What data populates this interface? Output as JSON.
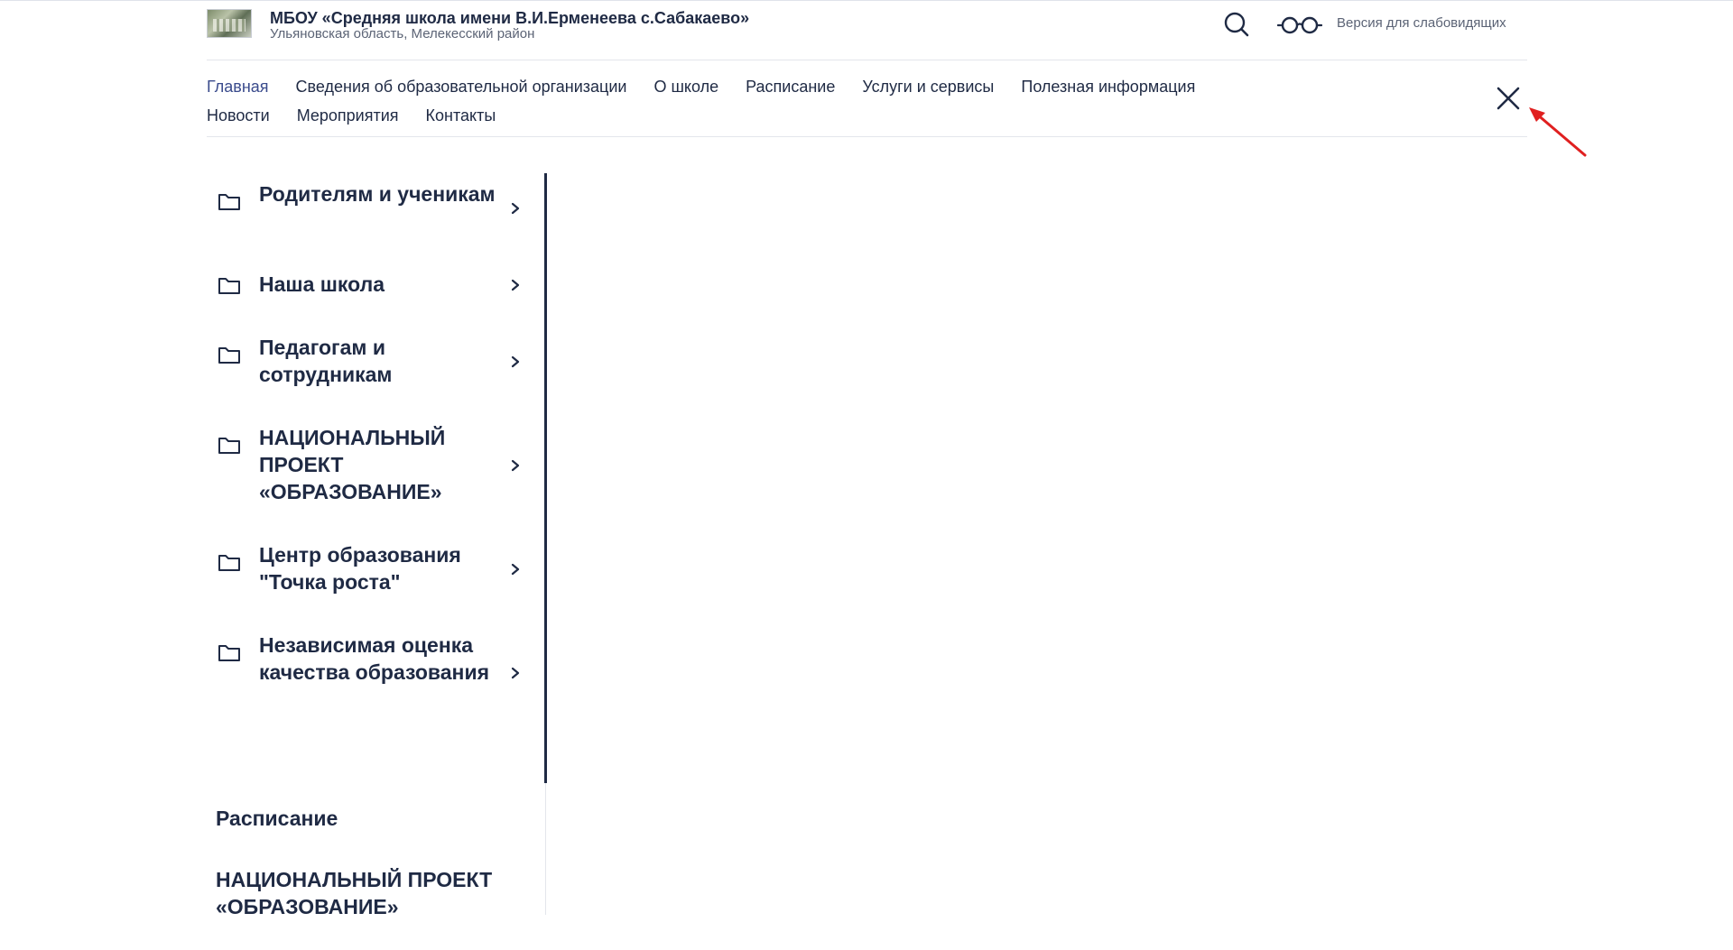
{
  "header": {
    "org_name": "МБОУ «Средняя школа имени В.И.Ерменеева с.Сабакаево»",
    "org_region": "Ульяновская область, Мелекесский район",
    "low_vision_label": "Версия для слабовидящих"
  },
  "nav": {
    "row1": [
      "Главная",
      "Сведения об образовательной организации",
      "О школе",
      "Расписание",
      "Услуги и сервисы",
      "Полезная информация"
    ],
    "row2": [
      "Новости",
      "Мероприятия",
      "Контакты"
    ],
    "active": "Главная"
  },
  "side_menu": {
    "items": [
      {
        "label": "Родителям и ученикам",
        "icon": "folder-icon"
      },
      {
        "label": "Наша школа",
        "icon": "folder-icon"
      },
      {
        "label": "Педагогам и сотрудникам",
        "icon": "folder-icon"
      },
      {
        "label": "НАЦИОНАЛЬНЫЙ ПРОЕКТ «ОБРАЗОВАНИЕ»",
        "icon": "folder-icon"
      },
      {
        "label": "Центр образования \"Точка роста\"",
        "icon": "folder-icon"
      },
      {
        "label": "Независимая оценка качества образования",
        "icon": "folder-icon"
      }
    ],
    "links": [
      "Расписание",
      "НАЦИОНАЛЬНЫЙ ПРОЕКТ «ОБРАЗОВАНИЕ»"
    ]
  },
  "colors": {
    "text": "#1f2a44",
    "accent": "#3a4b8c",
    "muted": "#5b6375",
    "annotation_arrow": "#e02020"
  }
}
